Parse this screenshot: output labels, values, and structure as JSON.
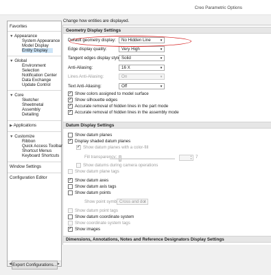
{
  "window": {
    "title": "Creo Parametric Options"
  },
  "nav": {
    "favorites": "Favorites",
    "appearance": "Appearance",
    "appearance_items": [
      "System Appearance",
      "Model Display",
      "Entity Display"
    ],
    "global": "Global",
    "global_items": [
      "Environment",
      "Selection",
      "Notification Center",
      "Data Exchange",
      "Update Control"
    ],
    "core": "Core",
    "core_items": [
      "Sketcher",
      "Sheetmetal",
      "Assembly",
      "Detailing"
    ],
    "applications": "Applications",
    "customize": "Customize",
    "customize_items": [
      "Ribbon",
      "Quick Access Toolbar",
      "Shortcut Menus",
      "Keyboard Shortcuts"
    ],
    "window_settings": "Window Settings",
    "configuration_editor": "Configuration Editor",
    "export_button": "Export Configurations..."
  },
  "main": {
    "description": "Change how entities are displayed.",
    "geometry_header": "Geometry Display Settings",
    "default_geometry_display_label": "Default geometry display:",
    "default_geometry_display_value": "No Hidden Line",
    "edge_quality_label": "Edge display quality:",
    "edge_quality_value": "Very High",
    "tangent_edges_label": "Tangent edges display style:",
    "tangent_edges_value": "Solid",
    "anti_aliasing_label": "Anti-Aliasing:",
    "anti_aliasing_value": "16 X",
    "lines_anti_aliasing_label": "Lines Anti-Aliasing:",
    "lines_anti_aliasing_value": "On",
    "text_anti_aliasing_label": "Text Anti-Aliasing:",
    "text_anti_aliasing_value": "Off",
    "geometry_checks": [
      "Show colors assigned to model surface",
      "Show silhouette edges",
      "Accurate removal of hidden lines in the part mode",
      "Accurate removal of hidden lines in the assembly mode"
    ],
    "datum_header": "Datum Display Settings",
    "show_datum_planes": "Show datum planes",
    "display_shaded_datum_planes": "Display shaded datum planes",
    "show_datum_planes_color_fill": "Show datum planes with a color-fill",
    "fill_transparency_label": "Fill transparency:",
    "fill_transparency_value": "7",
    "show_datums_camera": "Show datums during camera operations",
    "show_datum_plane_tags": "Show datum plane tags",
    "show_datum_axes": "Show datum axes",
    "show_datum_axis_tags": "Show datum axis tags",
    "show_datum_points": "Show datum points",
    "show_point_symbol_label": "Show point symbol as:",
    "show_point_symbol_value": "Cross and dot",
    "show_datum_point_tags": "Show datum point tags",
    "show_datum_coordinate_system": "Show datum coordinate system",
    "show_coordinate_system_tags": "Show coordinate system tags",
    "show_images": "Show images",
    "dimensions_header": "Dimensions, Annotations, Notes and Reference Designators Display Settings"
  },
  "colors": {
    "highlight": "#d42020",
    "selection": "#cce4f7"
  }
}
